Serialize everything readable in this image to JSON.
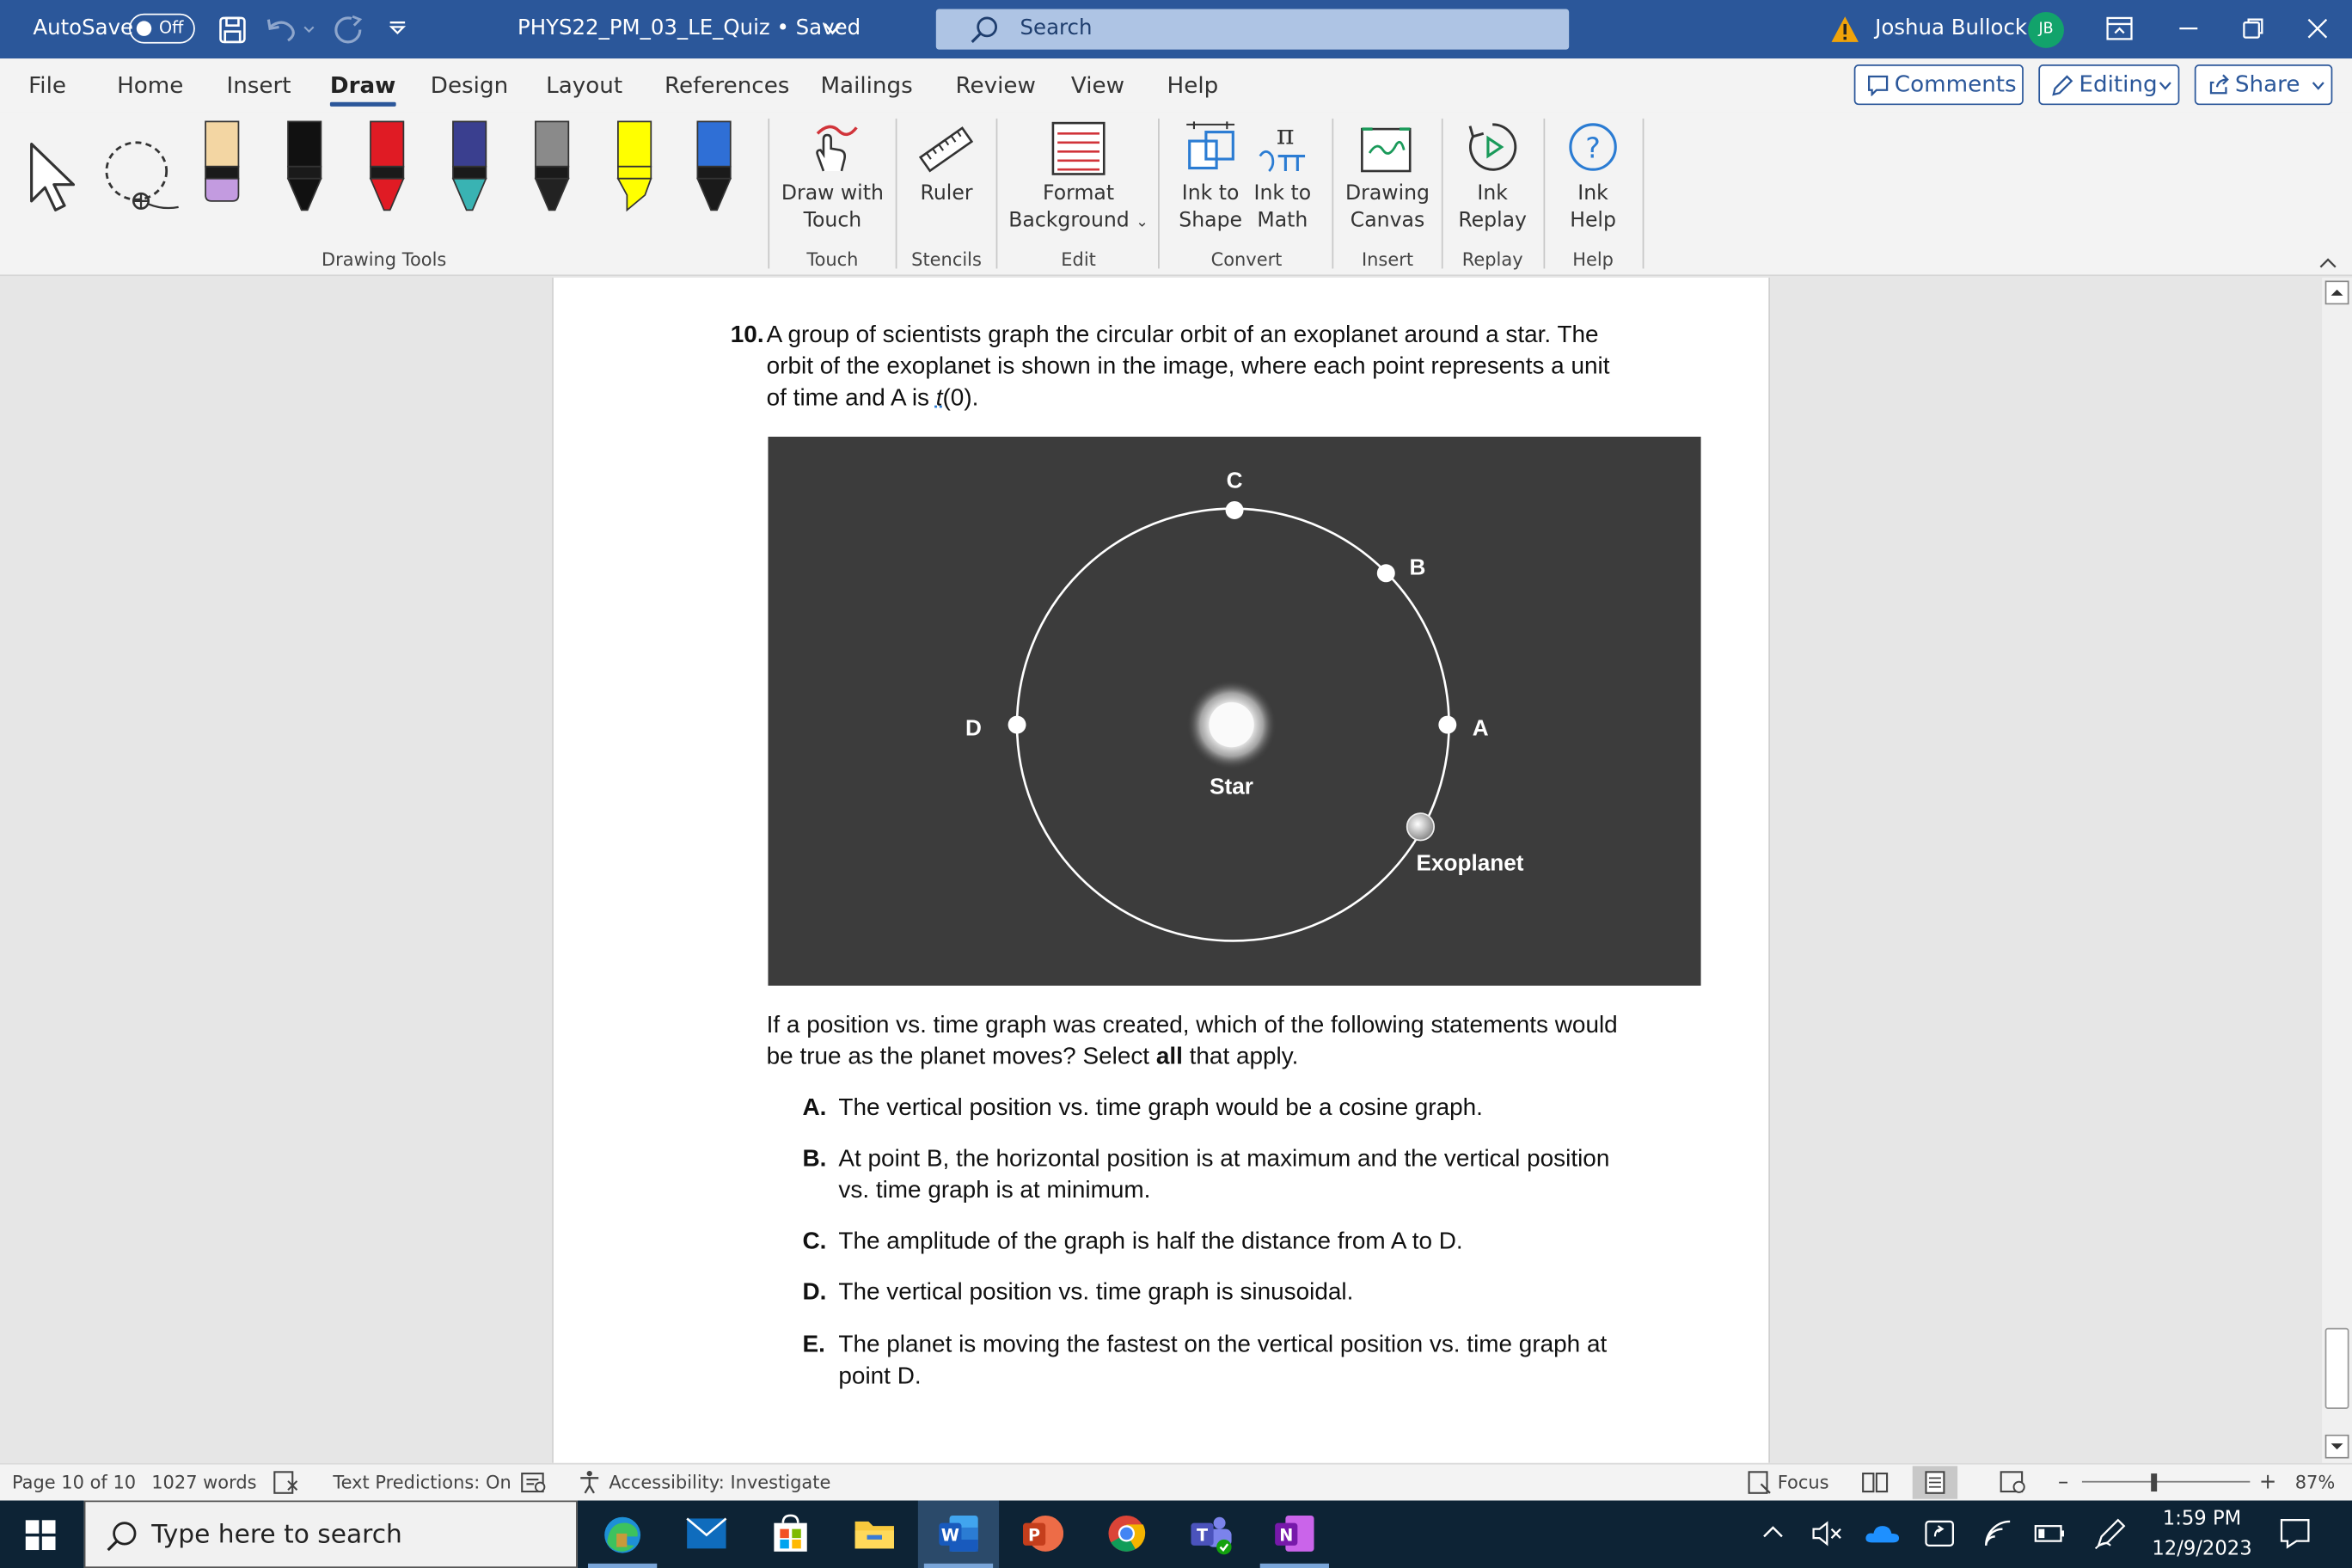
{
  "titlebar": {
    "autosave_label": "AutoSave",
    "autosave_state": "Off",
    "doc_title": "PHYS22_PM_03_LE_Quiz • Saved",
    "search_placeholder": "Search",
    "user_name": "Joshua Bullock",
    "user_initials": "JB",
    "color": "#2b579a"
  },
  "menu": {
    "tabs": [
      "File",
      "Home",
      "Insert",
      "Draw",
      "Design",
      "Layout",
      "References",
      "Mailings",
      "Review",
      "View",
      "Help"
    ],
    "active": "Draw",
    "comments": "Comments",
    "editing": "Editing",
    "share": "Share"
  },
  "ribbon": {
    "draw_with_touch": [
      "Draw with",
      "Touch"
    ],
    "ruler": "Ruler",
    "format_background": [
      "Format",
      "Background"
    ],
    "ink_to_shape": [
      "Ink to",
      "Shape"
    ],
    "ink_to_math": [
      "Ink to",
      "Math"
    ],
    "drawing_canvas": [
      "Drawing",
      "Canvas"
    ],
    "ink_replay": [
      "Ink",
      "Replay"
    ],
    "ink_help": [
      "Ink",
      "Help"
    ],
    "groups": {
      "drawing_tools": "Drawing Tools",
      "touch": "Touch",
      "stencils": "Stencils",
      "edit": "Edit",
      "convert": "Convert",
      "insert": "Insert",
      "replay": "Replay",
      "help": "Help"
    },
    "pens": [
      {
        "name": "pencil-lavender",
        "color": "#f3d6a3",
        "tip": "#c39be0"
      },
      {
        "name": "pen-black",
        "color": "#111111",
        "tip": "#111111"
      },
      {
        "name": "pen-red",
        "color": "#e01b24",
        "tip": "#e01b24"
      },
      {
        "name": "pen-galaxy",
        "color": "#3a3f8f",
        "tip": "#39b3b3"
      },
      {
        "name": "pen-gray",
        "color": "#8a8a8a",
        "tip": "#222222"
      },
      {
        "name": "highlighter-yellow",
        "color": "#ffff00",
        "tip": "#ffff00"
      },
      {
        "name": "pen-blue-sparkle",
        "color": "#2f6fd6",
        "tip": "#1a1a1a"
      }
    ]
  },
  "question": {
    "number": "10.",
    "stem_lines": [
      "A group of scientists graph the circular orbit of an exoplanet around a star. The",
      "orbit of the exoplanet is shown in the image, where each point represents a unit",
      "of time and A is "
    ],
    "stem_italic": "t",
    "stem_end": "(0).",
    "figure": {
      "background": "#3c3c3c",
      "labels": {
        "A": "A",
        "B": "B",
        "C": "C",
        "D": "D"
      },
      "star": "Star",
      "planet": "Exoplanet"
    },
    "prompt_lines": [
      "If a position vs. time graph was created, which of the following statements would",
      "be true as the planet moves? Select "
    ],
    "prompt_bold": "all",
    "prompt_end": " that apply.",
    "choices": [
      {
        "letter": "A.",
        "lines": [
          "The vertical position vs. time graph would be a cosine graph."
        ]
      },
      {
        "letter": "B.",
        "lines": [
          "At point B, the horizontal position is at maximum and the vertical position",
          "vs. time graph is at minimum."
        ]
      },
      {
        "letter": "C.",
        "lines": [
          "The amplitude of the graph is half the distance from A to D."
        ]
      },
      {
        "letter": "D.",
        "lines": [
          "The vertical position vs. time graph is sinusoidal."
        ]
      },
      {
        "letter": "E.",
        "lines": [
          "The planet is moving the fastest on the vertical position vs. time graph at",
          "point D."
        ]
      }
    ]
  },
  "status": {
    "page": "Page 10 of 10",
    "words": "1027 words",
    "predictions": "Text Predictions: On",
    "accessibility": "Accessibility: Investigate",
    "focus": "Focus",
    "zoom": "87%",
    "zoom_level": 0.87
  },
  "taskbar": {
    "search_placeholder": "Type here to search",
    "time": "1:59 PM",
    "date": "12/9/2023"
  }
}
